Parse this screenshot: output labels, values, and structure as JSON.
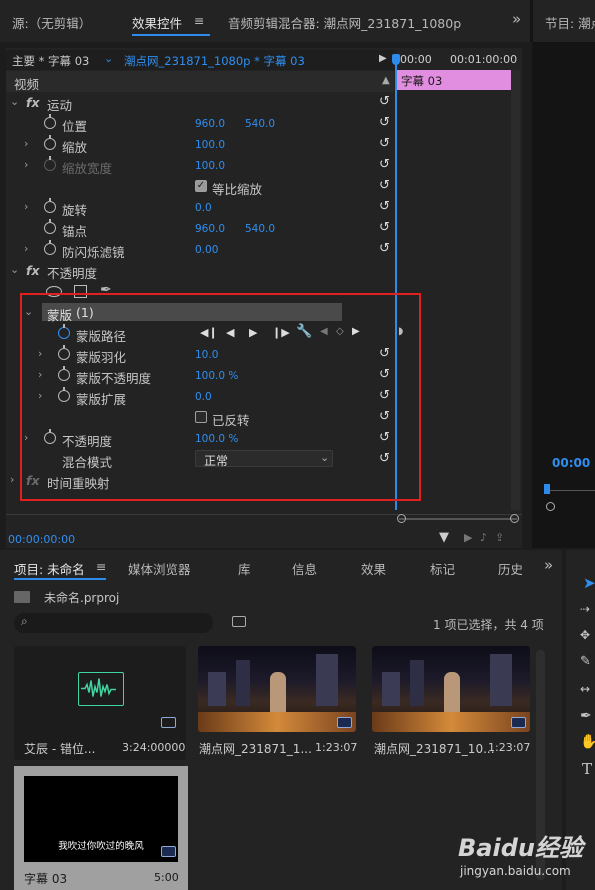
{
  "top_tabs": {
    "source": "源:（无剪辑）",
    "effects": "效果控件",
    "menu_glyph": "≡",
    "audio_mixer": "音频剪辑混合器: 潮点网_231871_1080p",
    "more": "»",
    "program": "节目: 潮点"
  },
  "effects_panel": {
    "master_label": "主要 * 字幕 03",
    "sequence_label": "潮点网_231871_1080p * 字幕 03",
    "ruler": {
      "t0": "00:00",
      "t1": "00:01:00:00"
    },
    "clip_label": "字幕 03",
    "video_header": "视频",
    "motion": {
      "fx": "fx",
      "label": "运动",
      "position": {
        "label": "位置",
        "x": "960.0",
        "y": "540.0"
      },
      "scale": {
        "label": "缩放",
        "value": "100.0"
      },
      "scale_width": {
        "label": "缩放宽度",
        "value": "100.0"
      },
      "uniform_scale": {
        "label": "等比缩放",
        "checked": true
      },
      "rotation": {
        "label": "旋转",
        "value": "0.0"
      },
      "anchor": {
        "label": "锚点",
        "x": "960.0",
        "y": "540.0"
      },
      "flicker": {
        "label": "防闪烁滤镜",
        "value": "0.00"
      }
    },
    "opacity": {
      "fx": "fx",
      "label": "不透明度",
      "mask": {
        "label": "蒙版",
        "count": "(1)",
        "path": {
          "label": "蒙版路径"
        },
        "feather": {
          "label": "蒙版羽化",
          "value": "10.0"
        },
        "mask_opacity": {
          "label": "蒙版不透明度",
          "value": "100.0 %"
        },
        "expansion": {
          "label": "蒙版扩展",
          "value": "0.0"
        },
        "inverted": {
          "label": "已反转",
          "checked": false
        }
      },
      "opacity_value": {
        "label": "不透明度",
        "value": "100.0 %"
      },
      "blend": {
        "label": "混合模式",
        "value": "正常"
      }
    },
    "time_remap": {
      "fx": "fx",
      "label": "时间重映射"
    },
    "timecode": "00:00:00:00",
    "highlight_color": "#e02020"
  },
  "program_panel": {
    "timecode": "00:00"
  },
  "project_panel": {
    "tabs": [
      "项目: 未命名",
      "媒体浏览器",
      "库",
      "信息",
      "效果",
      "标记",
      "历史"
    ],
    "file": "未命名.prproj",
    "search_placeholder": "",
    "selection": "1 项已选择，共 4 项",
    "items": [
      {
        "name": "艾辰 - 错位...",
        "duration": "3:24:00000"
      },
      {
        "name": "潮点网_231871_1...",
        "duration": "1:23:07"
      },
      {
        "name": "潮点网_231871_10...",
        "duration": "1:23:07"
      },
      {
        "name": "字幕 03",
        "duration": "5:00",
        "caption": "我吹过你吹过的晚风"
      }
    ]
  },
  "tools": [
    "selection-tool",
    "track-select-tool",
    "ripple-edit-tool",
    "razor-tool",
    "slip-tool",
    "pen-tool",
    "hand-tool",
    "type-tool"
  ],
  "watermark": {
    "brand": "Baidu经验",
    "url": "jingyan.baidu.com"
  }
}
